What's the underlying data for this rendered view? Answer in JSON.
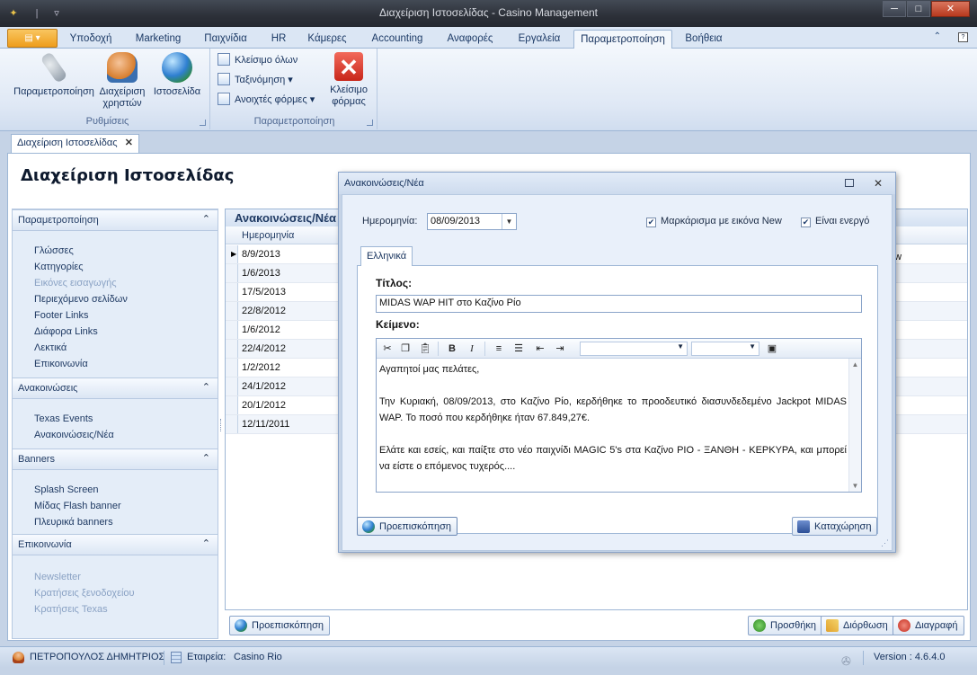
{
  "window": {
    "title": "Διαχείριση Ιστοσελίδας - Casino Management",
    "min": "─",
    "max": "□",
    "close": "✕"
  },
  "ribbon_tabs": [
    "Υποδοχή",
    "Marketing",
    "Παιχνίδια",
    "HR",
    "Κάμερες",
    "Accounting",
    "Αναφορές",
    "Εργαλεία",
    "Παραμετροποίηση",
    "Βοήθεια"
  ],
  "active_ribbon_tab": "Παραμετροποίηση",
  "ribbon": {
    "group1": {
      "label": "Ρυθμίσεις",
      "btn1": "Παραμετροποίηση",
      "btn2_l1": "Διαχείριση",
      "btn2_l2": "χρηστών",
      "btn3": "Ιστοσελίδα"
    },
    "group2": {
      "label": "Παραμετροποίηση",
      "close_all": "Κλείσιμο όλων",
      "sort": "Ταξινόμηση",
      "open_forms": "Ανοιχτές φόρμες",
      "close_form_l1": "Κλείσιμο",
      "close_form_l2": "φόρμας"
    }
  },
  "doc_tab": {
    "label": "Διαχείριση Ιστοσελίδας",
    "close": "✕"
  },
  "page_title": "Διαχείριση Ιστοσελίδας",
  "nav": {
    "sections": [
      {
        "title": "Παραμετροποίηση",
        "items": [
          "Γλώσσες",
          "Κατηγορίες",
          "Εικόνες εισαγωγής",
          "Περιεχόμενο σελίδων",
          "Footer Links",
          "Διάφορα Links",
          "Λεκτικά",
          "Επικοινωνία"
        ]
      },
      {
        "title": "Ανακοινώσεις",
        "items": [
          "Texas Events",
          "Ανακοινώσεις/Νέα"
        ]
      },
      {
        "title": "Banners",
        "items": [
          "Splash Screen",
          "Μίδας Flash banner",
          "Πλευρικά banners"
        ]
      },
      {
        "title": "Επικοινωνία",
        "items": [
          "Newsletter",
          "Κρατήσεις ξενοδοχείου",
          "Κρατήσεις Texas"
        ]
      }
    ]
  },
  "grid": {
    "title": "Ανακοινώσεις/Νέα",
    "column": "Ημερομηνία",
    "extra_col_text": "ew",
    "rows": [
      "8/9/2013",
      "1/6/2013",
      "17/5/2013",
      "22/8/2012",
      "1/6/2012",
      "22/4/2012",
      "1/2/2012",
      "24/1/2012",
      "20/1/2012",
      "12/11/2011"
    ]
  },
  "footer_buttons": {
    "preview": "Προεπισκόπηση",
    "add": "Προσθήκη",
    "edit": "Διόρθωση",
    "delete": "Διαγραφή"
  },
  "status": {
    "user": "ΠΕΤΡΟΠΟΥΛΟΣ ΔΗΜΗΤΡΙΟΣ",
    "company_label": "Εταιρεία:",
    "company": "Casino Rio",
    "version": "Version : 4.6.4.0"
  },
  "dialog": {
    "title": "Ανακοινώσεις/Νέα",
    "date_label": "Ημερομηνία:",
    "date_value": "08/09/2013",
    "mark_new_label": "Μαρκάρισμα με εικόνα New",
    "active_label": "Είναι ενεργό",
    "lang_tab": "Ελληνικά",
    "title_label": "Τίτλος:",
    "title_value": "MIDAS WAP HIT στο Καζίνο Ρίο",
    "body_label": "Κείμενο:",
    "body": {
      "p1": "Αγαπητοί μας πελάτες,",
      "p2": "Την Κυριακή, 08/09/2013, στο Καζίνο Ρίο, κερδήθηκε το προοδευτικό διασυνδεδεμένο Jackpot MIDAS WAP. Το ποσό που κερδήθηκε ήταν 67.849,27€.",
      "p3": "Ελάτε και εσείς, και παίξτε στο νέο παιχνίδι MAGIC 5's στα Καζίνο ΡΙΟ - ΞΑΝΘΗ - ΚΕΡΚΥΡΑ, και μπορεί να είστε ο επόμενος τυχερός...."
    },
    "preview": "Προεπισκόπηση",
    "save": "Καταχώρηση"
  }
}
